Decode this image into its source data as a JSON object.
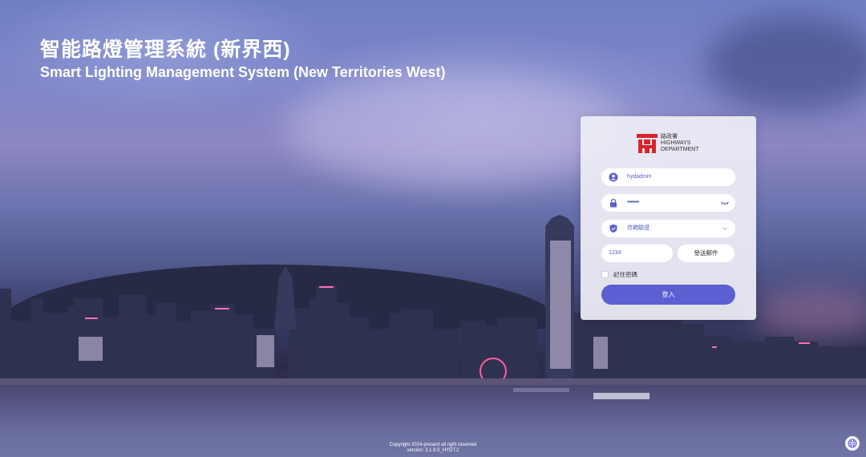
{
  "header": {
    "title_zh": "智能路燈管理系統 (新界西)",
    "title_en": "Smart Lighting Management System (New Territories West)"
  },
  "logo": {
    "line1": "路政署",
    "line2": "HIGHWAYS",
    "line3": "DEPARTMENT",
    "brand_color": "#d9232b"
  },
  "login_form": {
    "username_value": "hydadmin",
    "password_value": "••••••••••",
    "verify_method_value": "信箱驗證",
    "code_value": "1234",
    "send_email_label": "發送郵件",
    "remember_label": "記住密碼",
    "remember_checked": false,
    "login_label": "登入",
    "accent_color": "#5b5fd1"
  },
  "icons": {
    "username": "user-icon",
    "password": "lock-icon",
    "password_toggle": "eye-closed-icon",
    "verify_method": "shield-icon",
    "dropdown": "chevron-down-icon",
    "language": "globe-icon"
  },
  "footer": {
    "copyright": "Copyright 2024-present all right reserved",
    "version": "version: 3.1.9.0_HYDT.2"
  }
}
